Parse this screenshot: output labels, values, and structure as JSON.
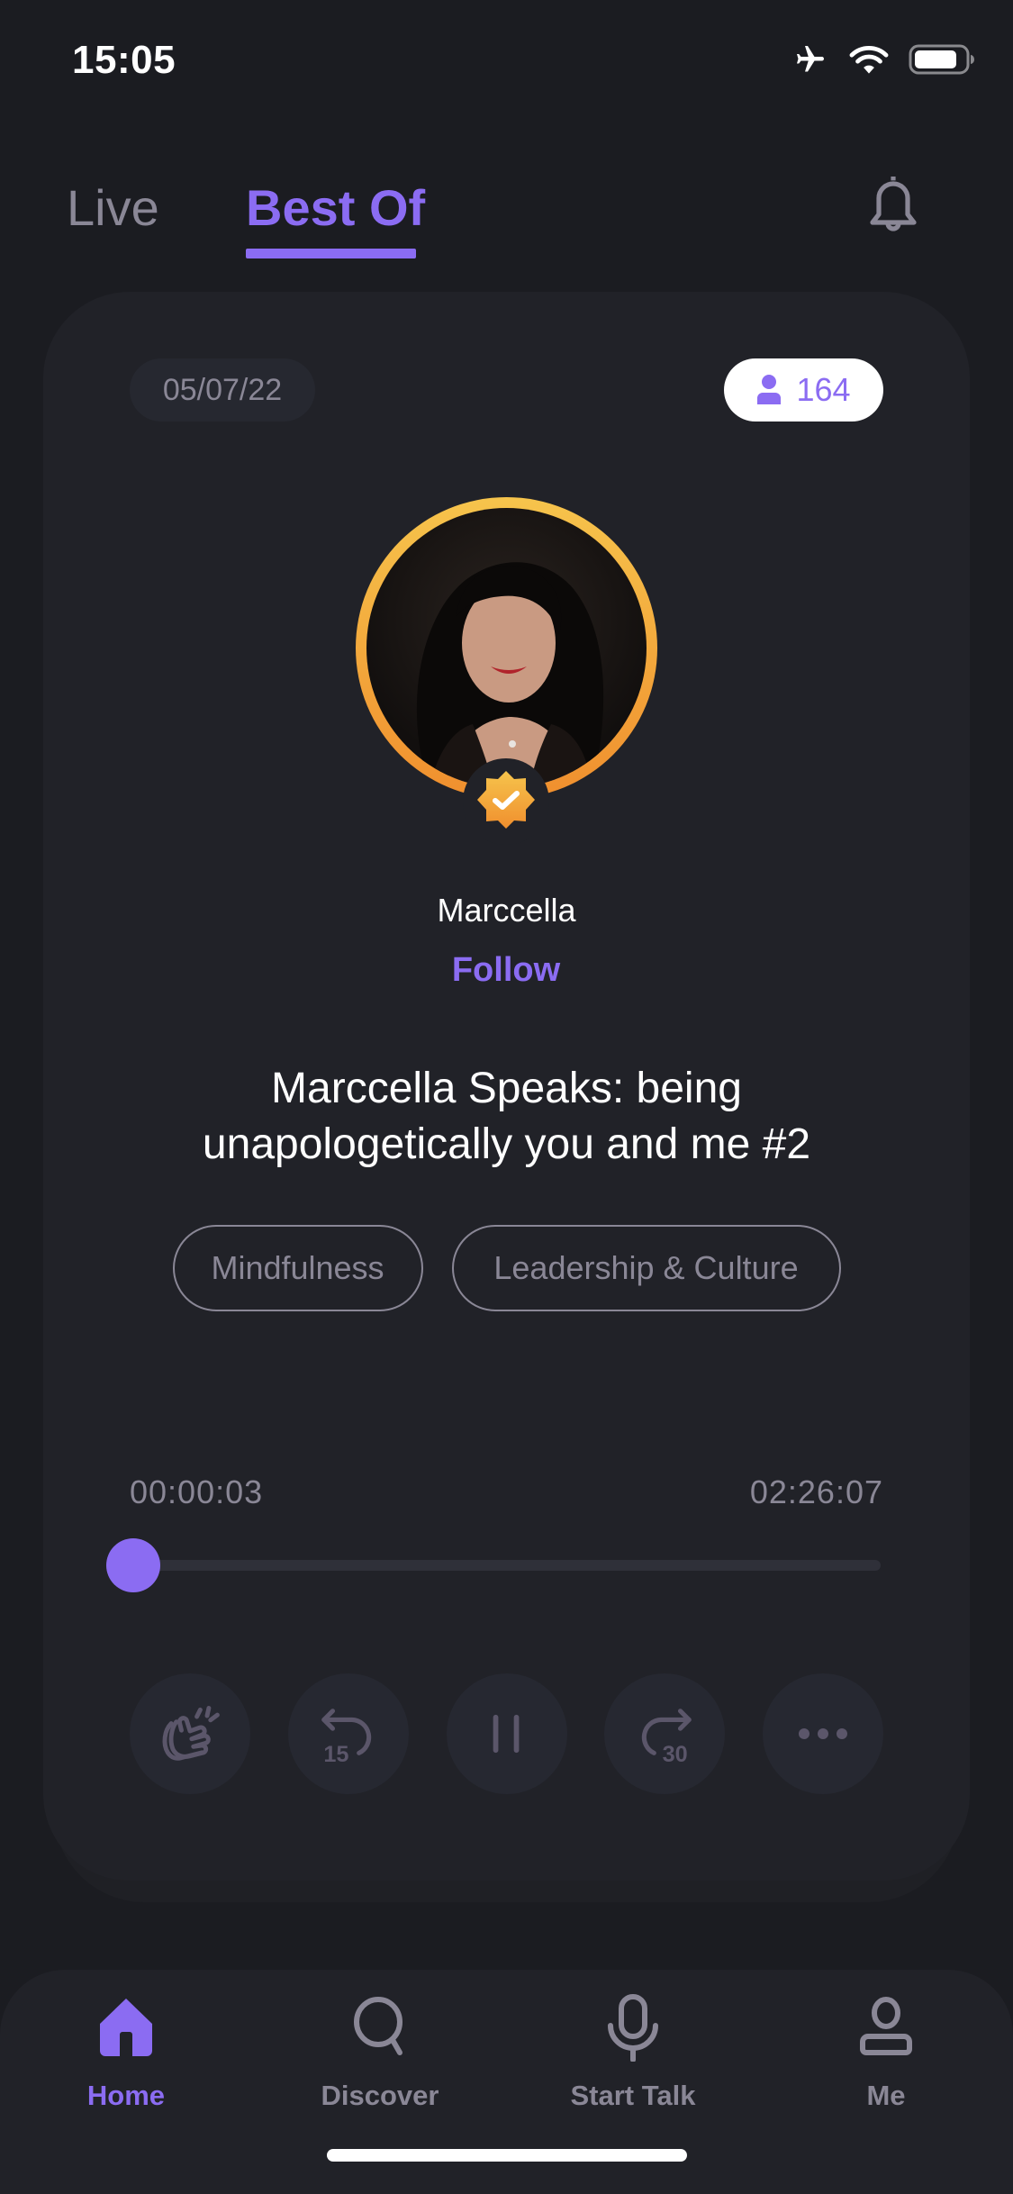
{
  "status_bar": {
    "time": "15:05",
    "icons": [
      "airplane-icon",
      "wifi-icon",
      "battery-icon"
    ]
  },
  "header": {
    "tabs": [
      {
        "label": "Live",
        "active": false
      },
      {
        "label": "Best Of",
        "active": true
      }
    ],
    "notification_icon": "bell-icon"
  },
  "talk_card": {
    "date": "05/07/22",
    "listener_count": "164",
    "host": {
      "name": "Marccella",
      "verified": true,
      "follow_label": "Follow"
    },
    "title": "Marccella Speaks: being unapologetically you and me #2",
    "tags": [
      "Mindfulness",
      "Leadership & Culture"
    ],
    "player": {
      "current_time": "00:00:03",
      "total_time": "02:26:07",
      "progress_fraction": 0.0003,
      "controls": [
        {
          "name": "clap",
          "icon": "clapping-hands-icon"
        },
        {
          "name": "rewind",
          "icon": "rewind-15-icon",
          "label": "15"
        },
        {
          "name": "pause",
          "icon": "pause-icon"
        },
        {
          "name": "forward",
          "icon": "forward-30-icon",
          "label": "30"
        },
        {
          "name": "more",
          "icon": "more-horizontal-icon"
        }
      ]
    }
  },
  "tab_bar": {
    "items": [
      {
        "label": "Home",
        "icon": "home-icon",
        "active": true
      },
      {
        "label": "Discover",
        "icon": "search-icon",
        "active": false
      },
      {
        "label": "Start Talk",
        "icon": "microphone-icon",
        "active": false
      },
      {
        "label": "Me",
        "icon": "profile-icon",
        "active": false
      }
    ]
  },
  "colors": {
    "accent": "#8b6cf2",
    "background": "#1b1c21",
    "card": "#212228",
    "muted_text": "#8a8796",
    "ring_gradient_top": "#f6c44c",
    "ring_gradient_bottom": "#f08f2e"
  }
}
